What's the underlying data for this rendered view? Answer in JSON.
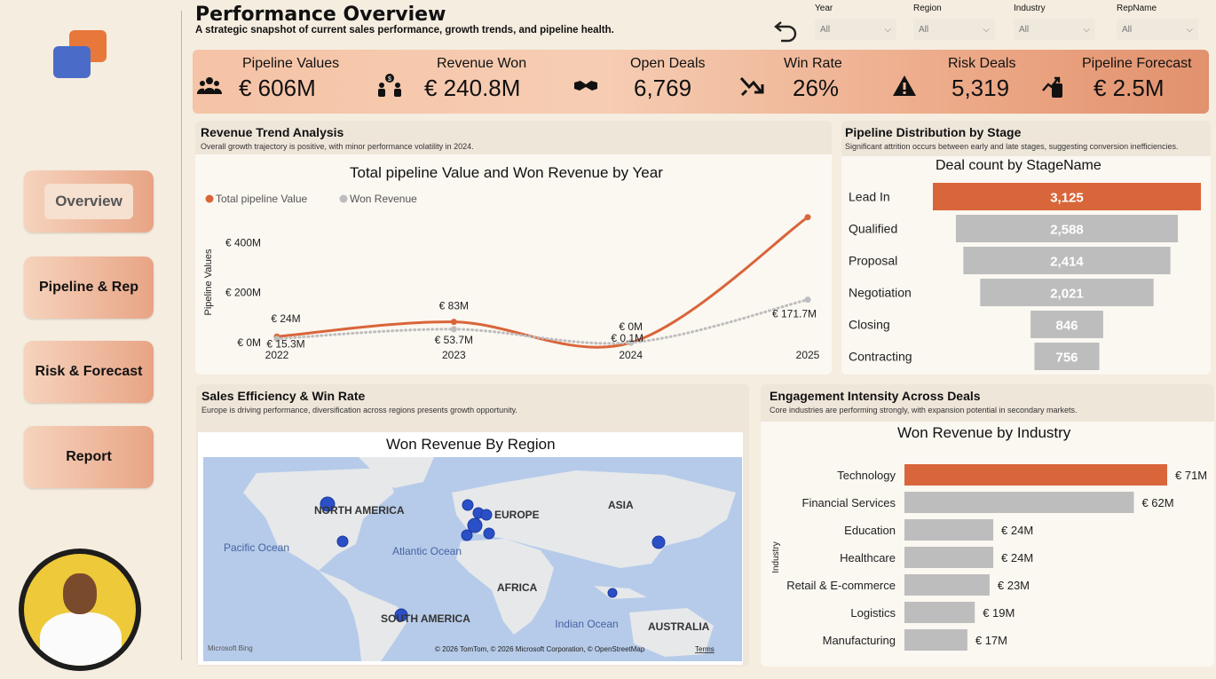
{
  "header": {
    "title": "Performance Overview",
    "subtitle": "A strategic snapshot of current sales performance, growth trends, and pipeline health."
  },
  "filters": [
    {
      "label": "Year",
      "value": "All"
    },
    {
      "label": "Region",
      "value": "All"
    },
    {
      "label": "Industry",
      "value": "All"
    },
    {
      "label": "RepName",
      "value": "All"
    }
  ],
  "nav": {
    "overview": "Overview",
    "pipeline": "Pipeline & Rep",
    "risk": "Risk & Forecast",
    "report": "Report"
  },
  "kpis": [
    {
      "label": "Pipeline Values",
      "value": "€ 606M",
      "icon": "people-group-icon"
    },
    {
      "label": "Revenue Won",
      "value": "€ 240.8M",
      "icon": "money-people-icon"
    },
    {
      "label": "Open Deals",
      "value": "6,769",
      "icon": "handshake-icon"
    },
    {
      "label": "Win Rate",
      "value": "26%",
      "icon": "trend-arrow-icon"
    },
    {
      "label": "Risk Deals",
      "value": "5,319",
      "icon": "warning-icon"
    },
    {
      "label": "Pipeline Forecast",
      "value": "€ 2.5M",
      "icon": "phone-chart-icon"
    }
  ],
  "revenue_panel": {
    "title": "Revenue Trend Analysis",
    "subtitle": "Overall growth trajectory is positive, with minor performance volatility in 2024."
  },
  "pipeline_panel": {
    "title": "Pipeline Distribution by Stage",
    "subtitle": "Significant attrition occurs between early and late stages, suggesting conversion inefficiencies."
  },
  "sales_panel": {
    "title": "Sales Efficiency & Win Rate",
    "subtitle": "Europe is driving performance, diversification across regions presents growth opportunity."
  },
  "engagement_panel": {
    "title": "Engagement Intensity Across Deals",
    "subtitle": "Core industries are performing strongly, with expansion potential in secondary markets."
  },
  "map": {
    "title": "Won Revenue By Region",
    "labels": {
      "north_america": "NORTH AMERICA",
      "europe": "EUROPE",
      "asia": "ASIA",
      "africa": "AFRICA",
      "south_america": "SOUTH AMERICA",
      "australia": "AUSTRALIA",
      "pacific": "Pacific Ocean",
      "atlantic": "Atlantic Ocean",
      "indian": "Indian Ocean"
    },
    "attribution": "© 2026 TomTom, © 2026 Microsoft Corporation, © OpenStreetMap",
    "terms": "Terms",
    "bing": "Microsoft Bing",
    "colors": {
      "water": "#b6cbe9",
      "land": "#e6e8ea",
      "bubble": "#2a4fc7"
    }
  },
  "chart_data": [
    {
      "type": "line",
      "title": "Total pipeline Value and Won Revenue by Year",
      "ylabel": "Pipeline Values",
      "x": [
        "2022",
        "2023",
        "2024",
        "2025"
      ],
      "y_ticks": [
        "€ 0M",
        "€ 200M",
        "€ 400M"
      ],
      "ylim": [
        0,
        540
      ],
      "legend_position": "top-left",
      "series": [
        {
          "name": "Total pipeline Value",
          "values": [
            24,
            83,
            0,
            502
          ],
          "labels": [
            "€ 24M",
            "€ 83M",
            "€ 0M",
            ""
          ],
          "color": "#d9653a"
        },
        {
          "name": "Won Revenue",
          "values": [
            15.3,
            53.7,
            0.1,
            171.7
          ],
          "labels": [
            "€ 15.3M",
            "€ 53.7M",
            "€ 0.1M",
            "€ 171.7M"
          ],
          "color": "#bdbdbd"
        }
      ]
    },
    {
      "type": "bar",
      "title": "Deal count by StageName",
      "categories": [
        "Lead In",
        "Qualified",
        "Proposal",
        "Negotiation",
        "Closing",
        "Contracting"
      ],
      "values": [
        3125,
        2588,
        2414,
        2021,
        846,
        756
      ],
      "labels": [
        "3,125",
        "2,588",
        "2,414",
        "2,021",
        "846",
        "756"
      ],
      "highlight_color": "#d9653a",
      "bar_color": "#bdbdbd"
    },
    {
      "type": "bar",
      "title": "Won Revenue by Industry",
      "ylabel": "Industry",
      "categories": [
        "Technology",
        "Financial Services",
        "Education",
        "Healthcare",
        "Retail & E-commerce",
        "Logistics",
        "Manufacturing"
      ],
      "values": [
        71,
        62,
        24,
        24,
        23,
        19,
        17
      ],
      "labels": [
        "€ 71M",
        "€ 62M",
        "€ 24M",
        "€ 24M",
        "€ 23M",
        "€ 19M",
        "€ 17M"
      ],
      "highlight_color": "#d9653a",
      "bar_color": "#bdbdbd"
    }
  ]
}
